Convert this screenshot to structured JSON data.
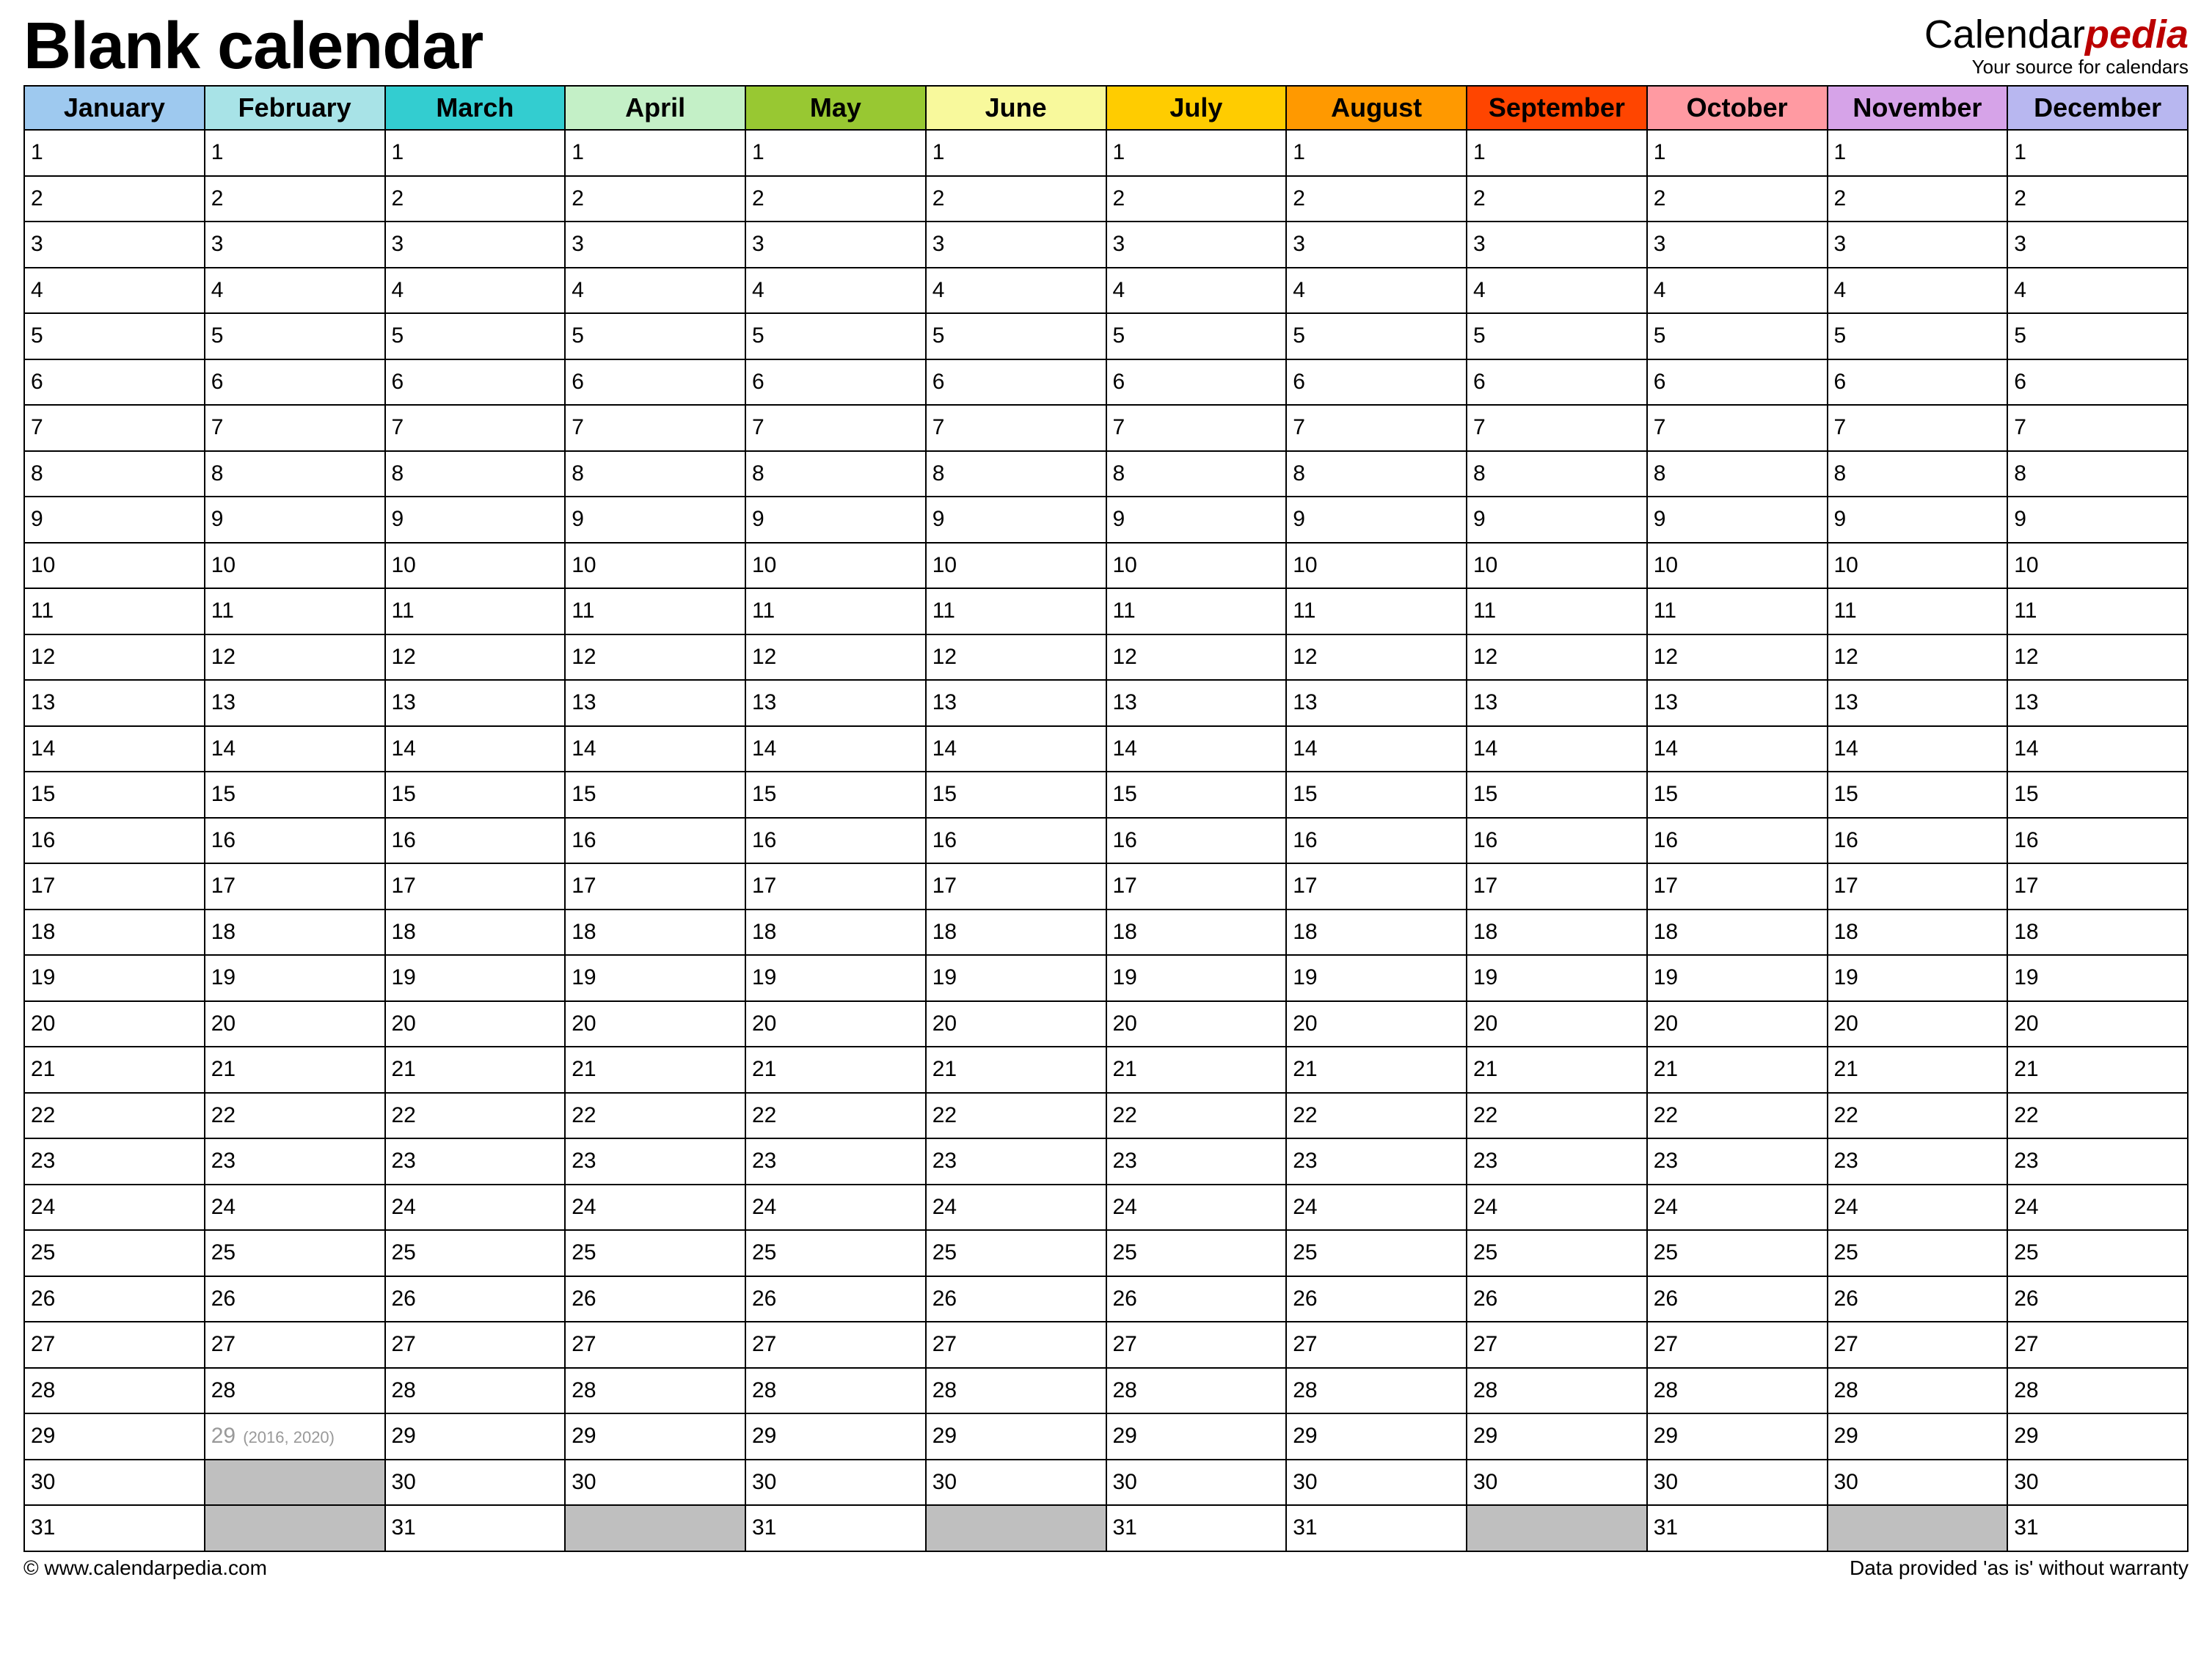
{
  "header": {
    "title": "Blank calendar",
    "brand_prefix": "Calendar",
    "brand_suffix": "pedia",
    "brand_sub": "Your source for calendars"
  },
  "months": [
    {
      "name": "January",
      "color": "#9ec9ef",
      "days": 31
    },
    {
      "name": "February",
      "color": "#a8e3e7",
      "days": 29,
      "leap_note": "(2016, 2020)"
    },
    {
      "name": "March",
      "color": "#33cdd0",
      "days": 31
    },
    {
      "name": "April",
      "color": "#c4f0c7",
      "days": 30
    },
    {
      "name": "May",
      "color": "#98c832",
      "days": 31
    },
    {
      "name": "June",
      "color": "#f8f99c",
      "days": 30
    },
    {
      "name": "July",
      "color": "#ffcc00",
      "days": 31
    },
    {
      "name": "August",
      "color": "#ff9900",
      "days": 31
    },
    {
      "name": "September",
      "color": "#ff4500",
      "days": 30
    },
    {
      "name": "October",
      "color": "#ff9aa2",
      "days": 31
    },
    {
      "name": "November",
      "color": "#d6a3e8",
      "days": 30
    },
    {
      "name": "December",
      "color": "#b8b7f0",
      "days": 31
    }
  ],
  "max_rows": 31,
  "footer": {
    "left": "© www.calendarpedia.com",
    "right": "Data provided 'as is' without warranty"
  }
}
